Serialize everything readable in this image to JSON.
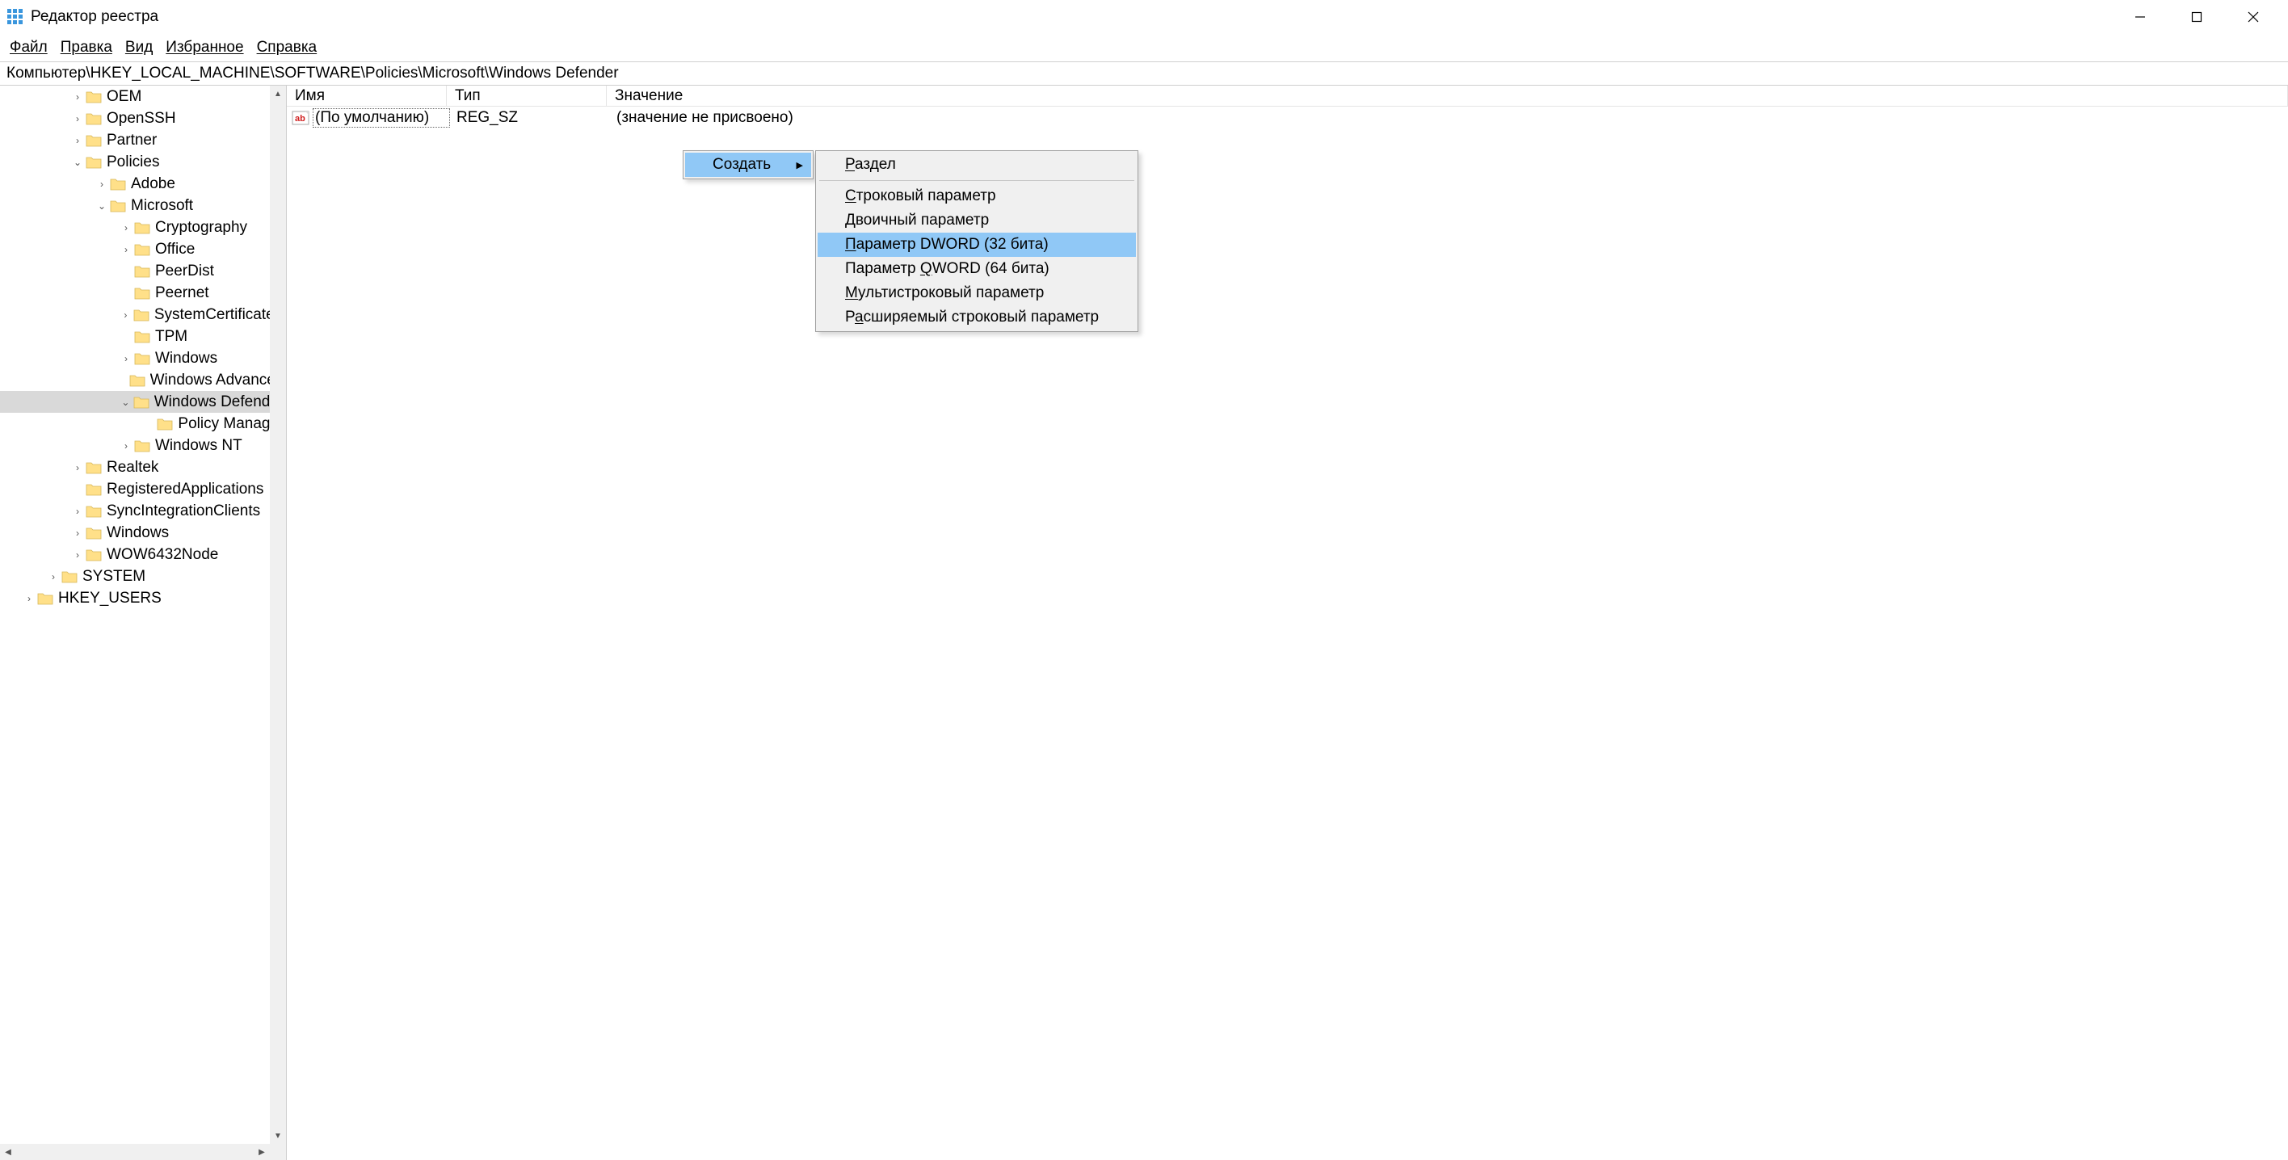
{
  "window": {
    "title": "Редактор реестра"
  },
  "menubar": {
    "file": "Файл",
    "edit": "Правка",
    "view": "Вид",
    "favorites": "Избранное",
    "help": "Справка"
  },
  "addressbar": {
    "path": "Компьютер\\HKEY_LOCAL_MACHINE\\SOFTWARE\\Policies\\Microsoft\\Windows Defender"
  },
  "tree": {
    "items": [
      {
        "indent": 3,
        "chev": ">",
        "label": "OEM"
      },
      {
        "indent": 3,
        "chev": ">",
        "label": "OpenSSH"
      },
      {
        "indent": 3,
        "chev": ">",
        "label": "Partner"
      },
      {
        "indent": 3,
        "chev": "v",
        "label": "Policies"
      },
      {
        "indent": 4,
        "chev": ">",
        "label": "Adobe"
      },
      {
        "indent": 4,
        "chev": "v",
        "label": "Microsoft"
      },
      {
        "indent": 5,
        "chev": ">",
        "label": "Cryptography"
      },
      {
        "indent": 5,
        "chev": ">",
        "label": "Office"
      },
      {
        "indent": 5,
        "chev": "",
        "label": "PeerDist"
      },
      {
        "indent": 5,
        "chev": "",
        "label": "Peernet"
      },
      {
        "indent": 5,
        "chev": ">",
        "label": "SystemCertificates"
      },
      {
        "indent": 5,
        "chev": "",
        "label": "TPM"
      },
      {
        "indent": 5,
        "chev": ">",
        "label": "Windows"
      },
      {
        "indent": 5,
        "chev": "",
        "label": "Windows Advanced Threat Protection"
      },
      {
        "indent": 5,
        "chev": "v",
        "label": "Windows Defender",
        "selected": true
      },
      {
        "indent": 6,
        "chev": "",
        "label": "Policy Manager"
      },
      {
        "indent": 5,
        "chev": ">",
        "label": "Windows NT"
      },
      {
        "indent": 3,
        "chev": ">",
        "label": "Realtek"
      },
      {
        "indent": 3,
        "chev": "",
        "label": "RegisteredApplications"
      },
      {
        "indent": 3,
        "chev": ">",
        "label": "SyncIntegrationClients"
      },
      {
        "indent": 3,
        "chev": ">",
        "label": "Windows"
      },
      {
        "indent": 3,
        "chev": ">",
        "label": "WOW6432Node"
      },
      {
        "indent": 2,
        "chev": ">",
        "label": "SYSTEM"
      },
      {
        "indent": 1,
        "chev": ">",
        "label": "HKEY_USERS"
      }
    ]
  },
  "values": {
    "columns": {
      "name": "Имя",
      "type": "Тип",
      "value": "Значение"
    },
    "rows": [
      {
        "name": "(По умолчанию)",
        "type": "REG_SZ",
        "value": "(значение не присвоено)",
        "icon": "ab"
      }
    ]
  },
  "context_menu": {
    "create": "Создать",
    "submenu": {
      "section": "Раздел",
      "string": "Строковый параметр",
      "binary": "Двоичный параметр",
      "dword": "Параметр DWORD (32 бита)",
      "qword": "Параметр QWORD (64 бита)",
      "multistring": "Мультистроковый параметр",
      "expandstring": "Расширяемый строковый параметр"
    }
  }
}
